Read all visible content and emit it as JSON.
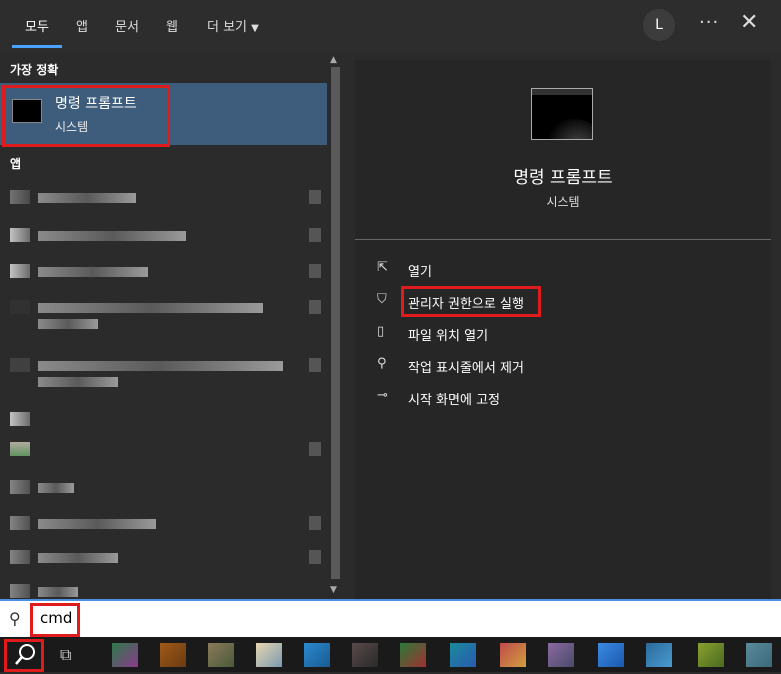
{
  "tabs": [
    "모두",
    "앱",
    "문서",
    "웹",
    "더 보기"
  ],
  "account_initial": "L",
  "more_glyph": "···",
  "close_glyph": "✕",
  "best_match": {
    "heading": "가장 정확",
    "title": "명령 프롬프트",
    "subtitle": "시스템"
  },
  "apps_heading": "앱",
  "detail": {
    "title": "명령 프롬프트",
    "subtitle": "시스템",
    "actions": [
      {
        "icon": "open-icon",
        "glyph": "⇱",
        "label": "열기"
      },
      {
        "icon": "admin-shield-icon",
        "glyph": "⛉",
        "label": "관리자 권한으로 실행"
      },
      {
        "icon": "file-location-icon",
        "glyph": "▯",
        "label": "파일 위치 열기"
      },
      {
        "icon": "unpin-icon",
        "glyph": "⚲",
        "label": "작업 표시줄에서 제거"
      },
      {
        "icon": "pin-icon",
        "glyph": "⊸",
        "label": "시작 화면에 고정"
      }
    ]
  },
  "search": {
    "value": "cmd"
  },
  "colors": {
    "accent": "#4aa3ff",
    "selection": "#3e5d7c",
    "highlight_box": "#e01b1b"
  }
}
